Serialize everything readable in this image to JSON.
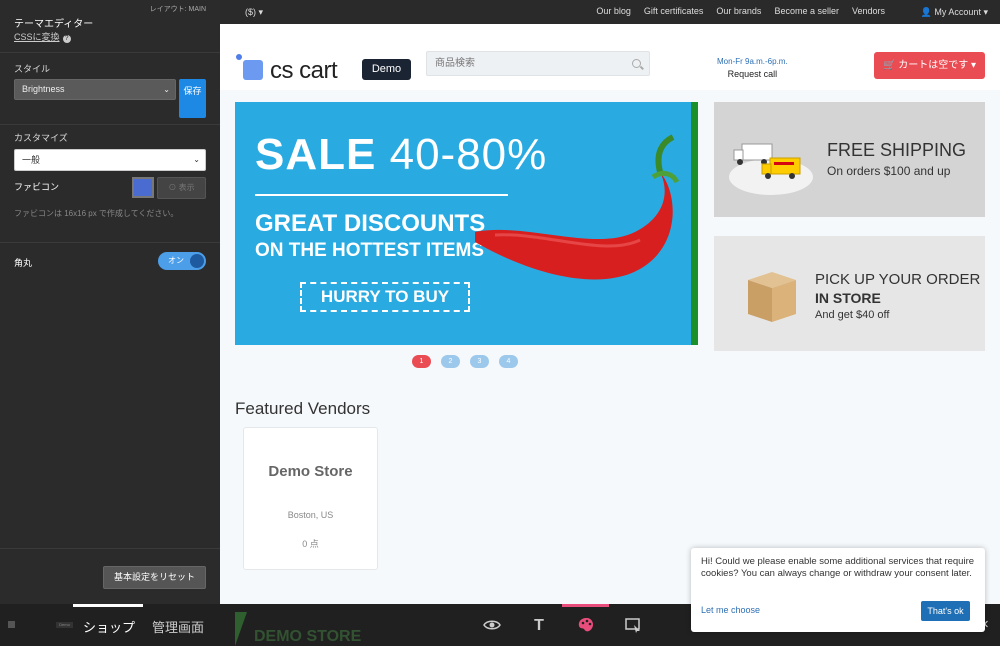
{
  "editor": {
    "layout_label": "レイアウト: MAIN",
    "title": "テーマエディター",
    "css_link": "CSSに変換",
    "style_label": "スタイル",
    "style_value": "Brightness",
    "save_label": "保存",
    "customize_label": "カスタマイズ",
    "general_value": "一般",
    "favicon_label": "ファビコン",
    "favicon_button": "⊙ 表示",
    "favicon_hint": "ファビコンは 16x16 px で作成してください。",
    "rounded_label": "角丸",
    "rounded_toggle": "オン",
    "reset_label": "基本設定をリセット"
  },
  "topbar": {
    "currency": "($)",
    "links": [
      "Our blog",
      "Gift certificates",
      "Our brands",
      "Become a seller",
      "Vendors"
    ],
    "account": "My Account"
  },
  "header": {
    "logo_text": "cs cart",
    "logo_badge": "Demo",
    "search_placeholder": "商品検索",
    "hours": "Mon-Fr 9a.m.-6p.m.",
    "request_call": "Request call",
    "cart_label": "カートは空です"
  },
  "banner": {
    "sale_word": "SALE",
    "sale_range": "40-80%",
    "line1": "GREAT DISCOUNTS",
    "line2": "ON THE HOTTEST ITEMS",
    "cta": "HURRY TO BUY",
    "dots": [
      "1",
      "2",
      "3",
      "4"
    ],
    "active_dot": 1
  },
  "promos": {
    "shipping_title": "FREE SHIPPING",
    "shipping_sub": "On orders $100 and up",
    "pickup_title": "PICK UP YOUR ORDER",
    "pickup_title2": "IN STORE",
    "pickup_sub": "And get $40 off"
  },
  "vendors": {
    "title": "Featured Vendors",
    "card": {
      "name": "Demo Store",
      "location": "Boston, US",
      "rating": "0 点"
    }
  },
  "bottombar": {
    "tab_shop": "ショップ",
    "tab_admin": "管理画面",
    "demo_store_text": "DEMO STORE",
    "mini_demo": "Demo"
  },
  "cookie": {
    "message": "Hi! Could we please enable some additional services that require cookies? You can always change or withdraw your consent later.",
    "let_me_choose": "Let me choose",
    "ok": "That's ok"
  },
  "colors": {
    "accent_blue": "#1e88e5",
    "cart_red": "#ea4c53",
    "banner_blue": "#29abe2",
    "toolbar_pink": "#e94d7c"
  }
}
